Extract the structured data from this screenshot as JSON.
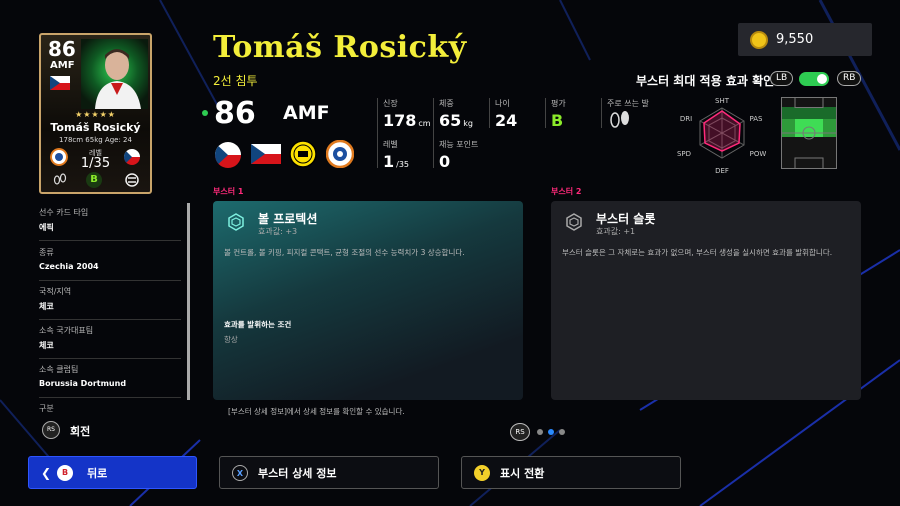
{
  "card": {
    "rating": "86",
    "position": "AMF",
    "stars": "★★★★★",
    "name": "Tomáš Rosický",
    "info": "178cm 65kg Age: 24",
    "level_label": "레벨",
    "level": "1/35",
    "grade": "B"
  },
  "player": {
    "name": "Tomáš Rosický",
    "playstyle": "2선 침투",
    "rating": "86",
    "position": "AMF"
  },
  "coins": "9,550",
  "booster_toggle": {
    "label": "부스터 최대 적용 효과 확인",
    "lb": "LB",
    "rb": "RB",
    "enabled": true
  },
  "stats": {
    "height_label": "신장",
    "height": "178",
    "height_unit": "cm",
    "weight_label": "체중",
    "weight": "65",
    "weight_unit": "kg",
    "age_label": "나이",
    "age": "24",
    "grade_label": "평가",
    "grade": "B",
    "foot_label": "주로 쓰는 발",
    "level_label": "레벨",
    "level": "1",
    "level_max": "/35",
    "skill_label": "재능 포인트",
    "skill_points": "0"
  },
  "radar": {
    "labels": [
      "SHT",
      "PAS",
      "POW",
      "DEF",
      "SPD",
      "DRI"
    ]
  },
  "booster1": {
    "section": "부스터 1",
    "title": "볼 프로텍션",
    "effect": "효과값: +3",
    "desc": "볼 컨트롤, 볼 키핑, 피지컬 콘택트, 균형 조절의 선수 능력치가 3 상승합니다.",
    "cond_label": "효과를 발휘하는 조건",
    "cond": "항상"
  },
  "booster2": {
    "section": "부스터 2",
    "title": "부스터 슬롯",
    "effect": "효과값: +1",
    "desc": "부스터 슬롯은 그 자체로는 효과가 없으며, 부스터 생성을 실시하면 효과를 발휘합니다."
  },
  "hint": "[부스터 상세 정보]에서 상세 정보를 확인할 수 있습니다.",
  "side": [
    {
      "label": "선수 카드 타입",
      "value": "에픽"
    },
    {
      "label": "종류",
      "value": "Czechia 2004"
    },
    {
      "label": "국적/지역",
      "value": "체코"
    },
    {
      "label": "소속 국가대표팀",
      "value": "체코"
    },
    {
      "label": "소속 클럽팀",
      "value": "Borussia Dortmund"
    },
    {
      "label": "구분",
      "value": ""
    }
  ],
  "rotate": {
    "key": "RS",
    "label": "회전"
  },
  "pager": {
    "key": "RS"
  },
  "buttons": {
    "back_key": "B",
    "back": "뒤로",
    "detail_key": "X",
    "detail": "부스터 상세 정보",
    "toggle_key": "Y",
    "toggle": "표시 전환"
  },
  "colors": {
    "accent_yellow": "#f3ee3a",
    "booster_pink": "#ff2a7a",
    "active_blue": "#1434c8",
    "green": "#2ecc52"
  }
}
